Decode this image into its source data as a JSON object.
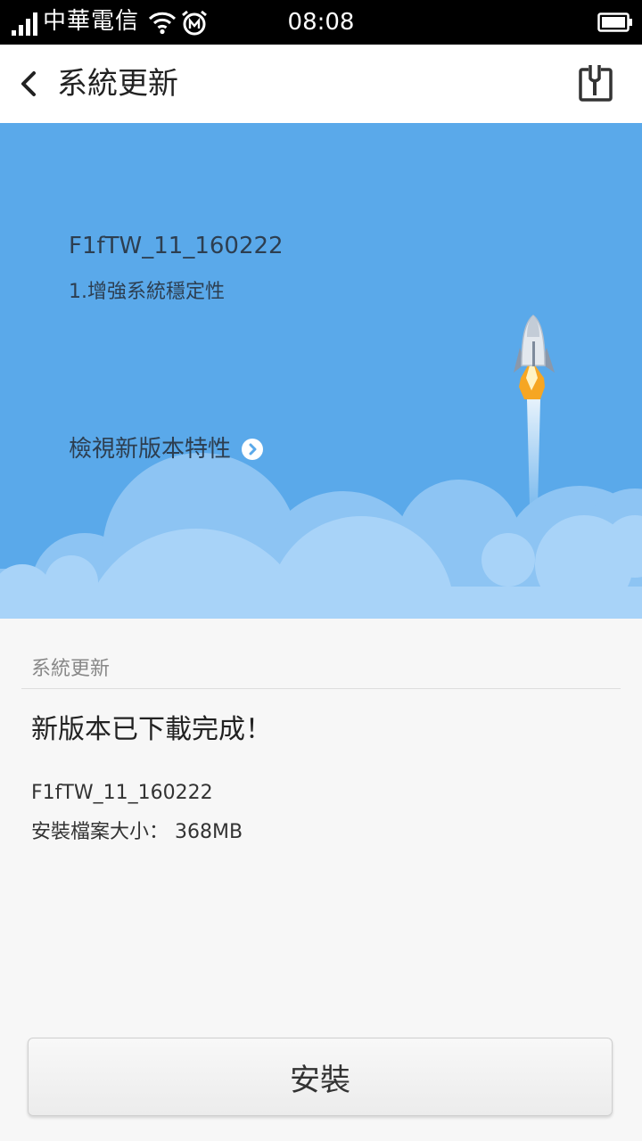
{
  "status_bar": {
    "carrier": "中華電信",
    "time": "08:08",
    "icons": [
      "signal-icon",
      "wifi-icon",
      "alarm-icon",
      "battery-icon"
    ]
  },
  "header": {
    "title": "系統更新",
    "back_icon": "chevron-left-icon",
    "tool_icon": "tool-icon"
  },
  "hero": {
    "version": "F1fTW_11_160222",
    "note": "1.增強系統穩定性",
    "features_link": "檢視新版本特性",
    "features_icon": "chevron-right-icon",
    "illustration": "rocket-icon",
    "background_color": "#5aa9ea"
  },
  "content": {
    "section_label": "系統更新",
    "status": "新版本已下載完成！",
    "version": "F1fTW_11_160222",
    "size": "安裝檔案大小： 368MB"
  },
  "install_button": {
    "label": "安裝"
  }
}
